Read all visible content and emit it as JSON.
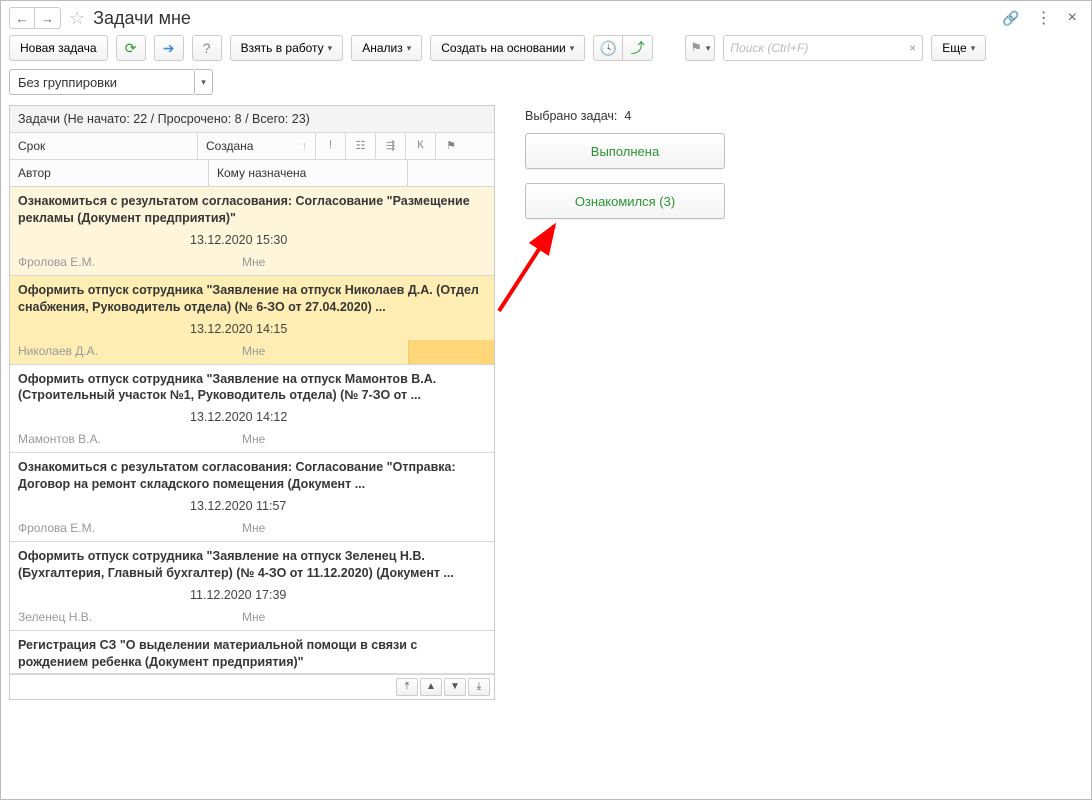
{
  "header": {
    "title": "Задачи мне"
  },
  "toolbar": {
    "new_task": "Новая задача",
    "take_work": "Взять в работу",
    "analysis": "Анализ",
    "create_based": "Создать на основании",
    "more": "Еще"
  },
  "search": {
    "placeholder": "Поиск (Ctrl+F)"
  },
  "grouping": {
    "value": "Без группировки"
  },
  "list_summary": "Задачи (Не начато: 22 / Просрочено: 8 / Всего: 23)",
  "cols": {
    "srok": "Срок",
    "sozdana": "Создана",
    "excl": "!",
    "group": "☷",
    "tree": "⇶",
    "k": "К",
    "flag": "⚑",
    "author": "Автор",
    "komu": "Кому назначена"
  },
  "tasks": [
    {
      "title": "Ознакомиться с результатом согласования: Согласование \"Размещение рекламы (Документ предприятия)\"",
      "date": "13.12.2020 15:30",
      "author": "Фролова Е.М.",
      "to": "Мне",
      "sel": "sel1"
    },
    {
      "title": "Оформить отпуск сотрудника \"Заявление на отпуск Николаев Д.А. (Отдел снабжения, Руководитель отдела) (№ 6-ЗО от 27.04.2020) ...",
      "date": "13.12.2020 14:15",
      "author": "Николаев Д.А.",
      "to": "Мне",
      "sel": "sel2"
    },
    {
      "title": "Оформить отпуск сотрудника \"Заявление на отпуск Мамонтов В.А. (Строительный участок №1, Руководитель отдела) (№ 7-ЗО от ...",
      "date": "13.12.2020 14:12",
      "author": "Мамонтов В.А.",
      "to": "Мне",
      "sel": ""
    },
    {
      "title": "Ознакомиться с результатом согласования: Согласование \"Отправка: Договор на ремонт складского помещения (Документ ...",
      "date": "13.12.2020 11:57",
      "author": "Фролова Е.М.",
      "to": "Мне",
      "sel": ""
    },
    {
      "title": "Оформить отпуск сотрудника \"Заявление на отпуск Зеленец Н.В. (Бухгалтерия, Главный бухгалтер) (№ 4-ЗО от 11.12.2020) (Документ ...",
      "date": "11.12.2020 17:39",
      "author": "Зеленец Н.В.",
      "to": "Мне",
      "sel": ""
    },
    {
      "title": "Регистрация СЗ \"О выделении материальной помощи в связи с рождением ребенка (Документ предприятия)\"",
      "date": "",
      "author": "",
      "to": "",
      "sel": ""
    }
  ],
  "side": {
    "selected_label": "Выбрано задач:",
    "selected_count": "4",
    "done": "Выполнена",
    "ack": "Ознакомился (3)"
  }
}
